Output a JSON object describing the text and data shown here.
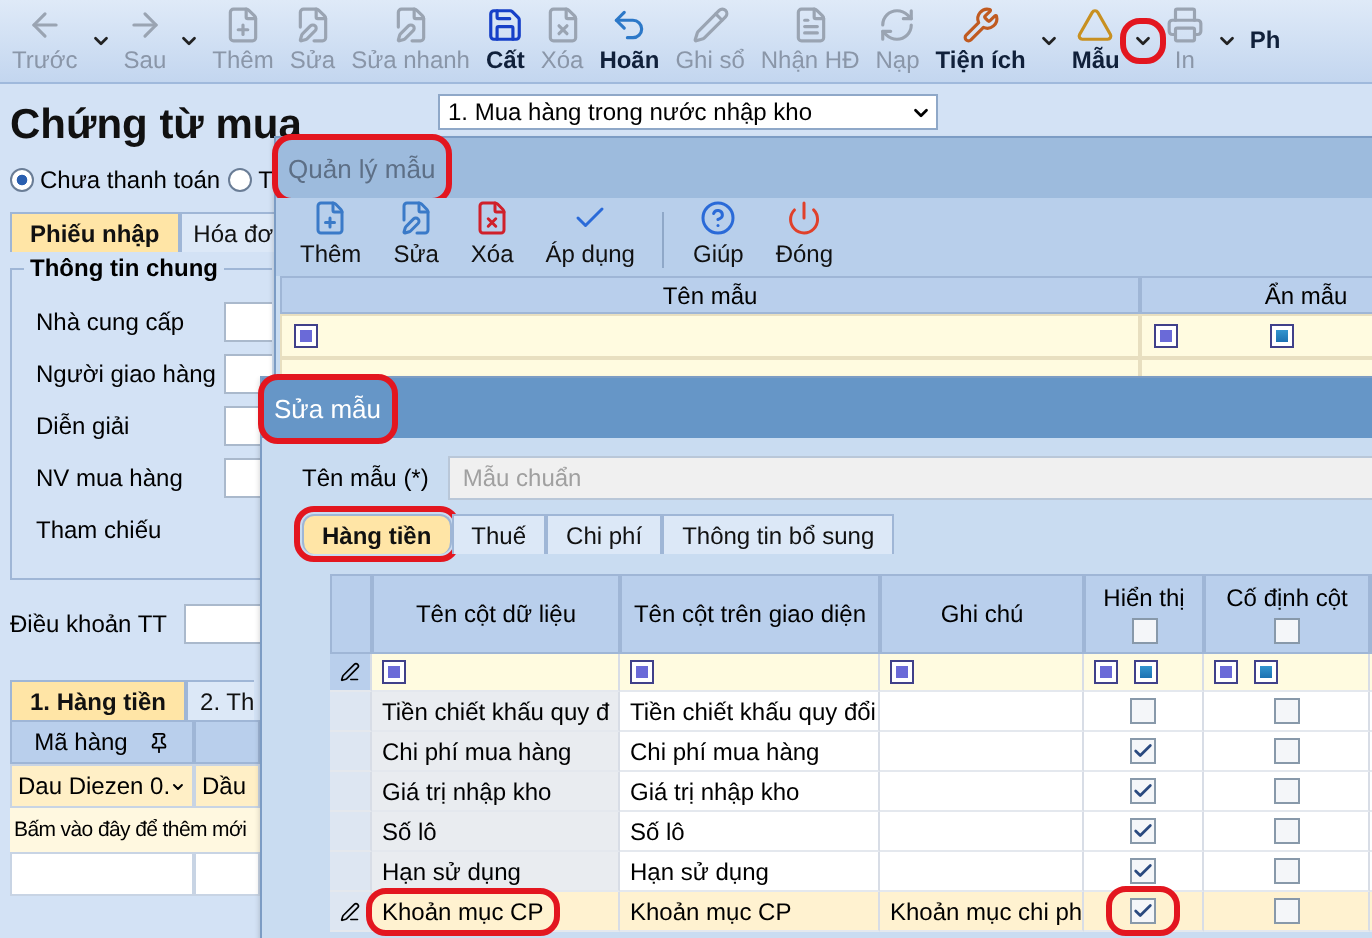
{
  "toolbar": [
    {
      "label": "Trước",
      "disabled": true,
      "dropdown": true,
      "highlighted": false
    },
    {
      "label": "Sau",
      "disabled": true,
      "dropdown": true,
      "highlighted": false
    },
    {
      "label": "Thêm",
      "disabled": true,
      "dropdown": false,
      "highlighted": false
    },
    {
      "label": "Sửa",
      "disabled": true,
      "dropdown": false,
      "highlighted": false
    },
    {
      "label": "Sửa nhanh",
      "disabled": true,
      "dropdown": false,
      "highlighted": false
    },
    {
      "label": "Cất",
      "disabled": false,
      "dropdown": false,
      "highlighted": false
    },
    {
      "label": "Xóa",
      "disabled": true,
      "dropdown": false,
      "highlighted": false
    },
    {
      "label": "Hoãn",
      "disabled": false,
      "dropdown": false,
      "highlighted": false
    },
    {
      "label": "Ghi sổ",
      "disabled": true,
      "dropdown": false,
      "highlighted": false
    },
    {
      "label": "Nhận HĐ",
      "disabled": true,
      "dropdown": false,
      "highlighted": false
    },
    {
      "label": "Nạp",
      "disabled": true,
      "dropdown": false,
      "highlighted": false
    },
    {
      "label": "Tiện ích",
      "disabled": false,
      "dropdown": true,
      "highlighted": false
    },
    {
      "label": "Mẫu",
      "disabled": false,
      "dropdown": true,
      "highlighted": true
    },
    {
      "label": "In",
      "disabled": true,
      "dropdown": true,
      "highlighted": false
    },
    {
      "label": "Ph",
      "disabled": false,
      "dropdown": false,
      "highlighted": false
    }
  ],
  "document": {
    "title": "Chứng từ mua",
    "type_combo": "1. Mua hàng trong nước nhập kho",
    "payment_options": [
      {
        "label": "Chưa thanh toán",
        "selected": true
      },
      {
        "label": "T",
        "selected": false
      }
    ],
    "tabs": [
      {
        "label": "Phiếu nhập",
        "selected": true
      },
      {
        "label": "Hóa đơ",
        "selected": false
      }
    ],
    "group_title": "Thông tin chung",
    "fields": [
      "Nhà cung cấp",
      "Người giao hàng",
      "Diễn giải",
      "NV mua hàng",
      "Tham chiếu"
    ],
    "payment_terms_label": "Điều khoản TT",
    "detail_tabs": [
      {
        "label": "1. Hàng tiền",
        "selected": true
      },
      {
        "label": "2. Th",
        "selected": false
      }
    ],
    "detail_columns": [
      "Mã hàng"
    ],
    "detail_rows": [
      [
        "Dau Diezen 0.",
        "Dầu"
      ]
    ],
    "new_row_hint": "Bấm vào đây để thêm mới"
  },
  "template_manager": {
    "title": "Quản lý mẫu",
    "highlighted": true,
    "actions": [
      "Thêm",
      "Sửa",
      "Xóa",
      "Áp dụng",
      "Giúp",
      "Đóng"
    ],
    "columns": [
      "Tên mẫu",
      "Ẩn mẫu"
    ]
  },
  "template_editor": {
    "title": "Sửa mẫu",
    "highlighted": true,
    "name_label": "Tên mẫu (*)",
    "name_value": "Mẫu chuẩn",
    "tabs": [
      {
        "label": "Hàng tiền",
        "selected": true,
        "highlighted": true
      },
      {
        "label": "Thuế",
        "selected": false,
        "highlighted": false
      },
      {
        "label": "Chi phí",
        "selected": false,
        "highlighted": false
      },
      {
        "label": "Thông tin bổ sung",
        "selected": false,
        "highlighted": false
      }
    ],
    "columns": [
      {
        "label": "Tên cột dữ liệu"
      },
      {
        "label": "Tên cột trên giao diện"
      },
      {
        "label": "Ghi chú"
      },
      {
        "label": "Hiển thị",
        "all_checked": false
      },
      {
        "label": "Cố định cột",
        "all_checked": false
      }
    ],
    "rows": [
      {
        "data_column": "Tiền chiết khấu quy đ",
        "display_name": "Tiền chiết khấu quy đổi",
        "note": "",
        "visible": false,
        "pinned": false,
        "current": false,
        "highlighted": false
      },
      {
        "data_column": "Chi phí mua hàng",
        "display_name": "Chi phí mua hàng",
        "note": "",
        "visible": true,
        "pinned": false,
        "current": false,
        "highlighted": false
      },
      {
        "data_column": "Giá trị nhập kho",
        "display_name": "Giá trị nhập kho",
        "note": "",
        "visible": true,
        "pinned": false,
        "current": false,
        "highlighted": false
      },
      {
        "data_column": "Số lô",
        "display_name": "Số lô",
        "note": "",
        "visible": true,
        "pinned": false,
        "current": false,
        "highlighted": false
      },
      {
        "data_column": "Hạn sử dụng",
        "display_name": "Hạn sử dụng",
        "note": "",
        "visible": true,
        "pinned": false,
        "current": false,
        "highlighted": false
      },
      {
        "data_column": "Khoản mục CP",
        "display_name": "Khoản mục CP",
        "note": "Khoản mục chi ph",
        "visible": true,
        "pinned": false,
        "current": true,
        "highlighted": true
      }
    ]
  }
}
